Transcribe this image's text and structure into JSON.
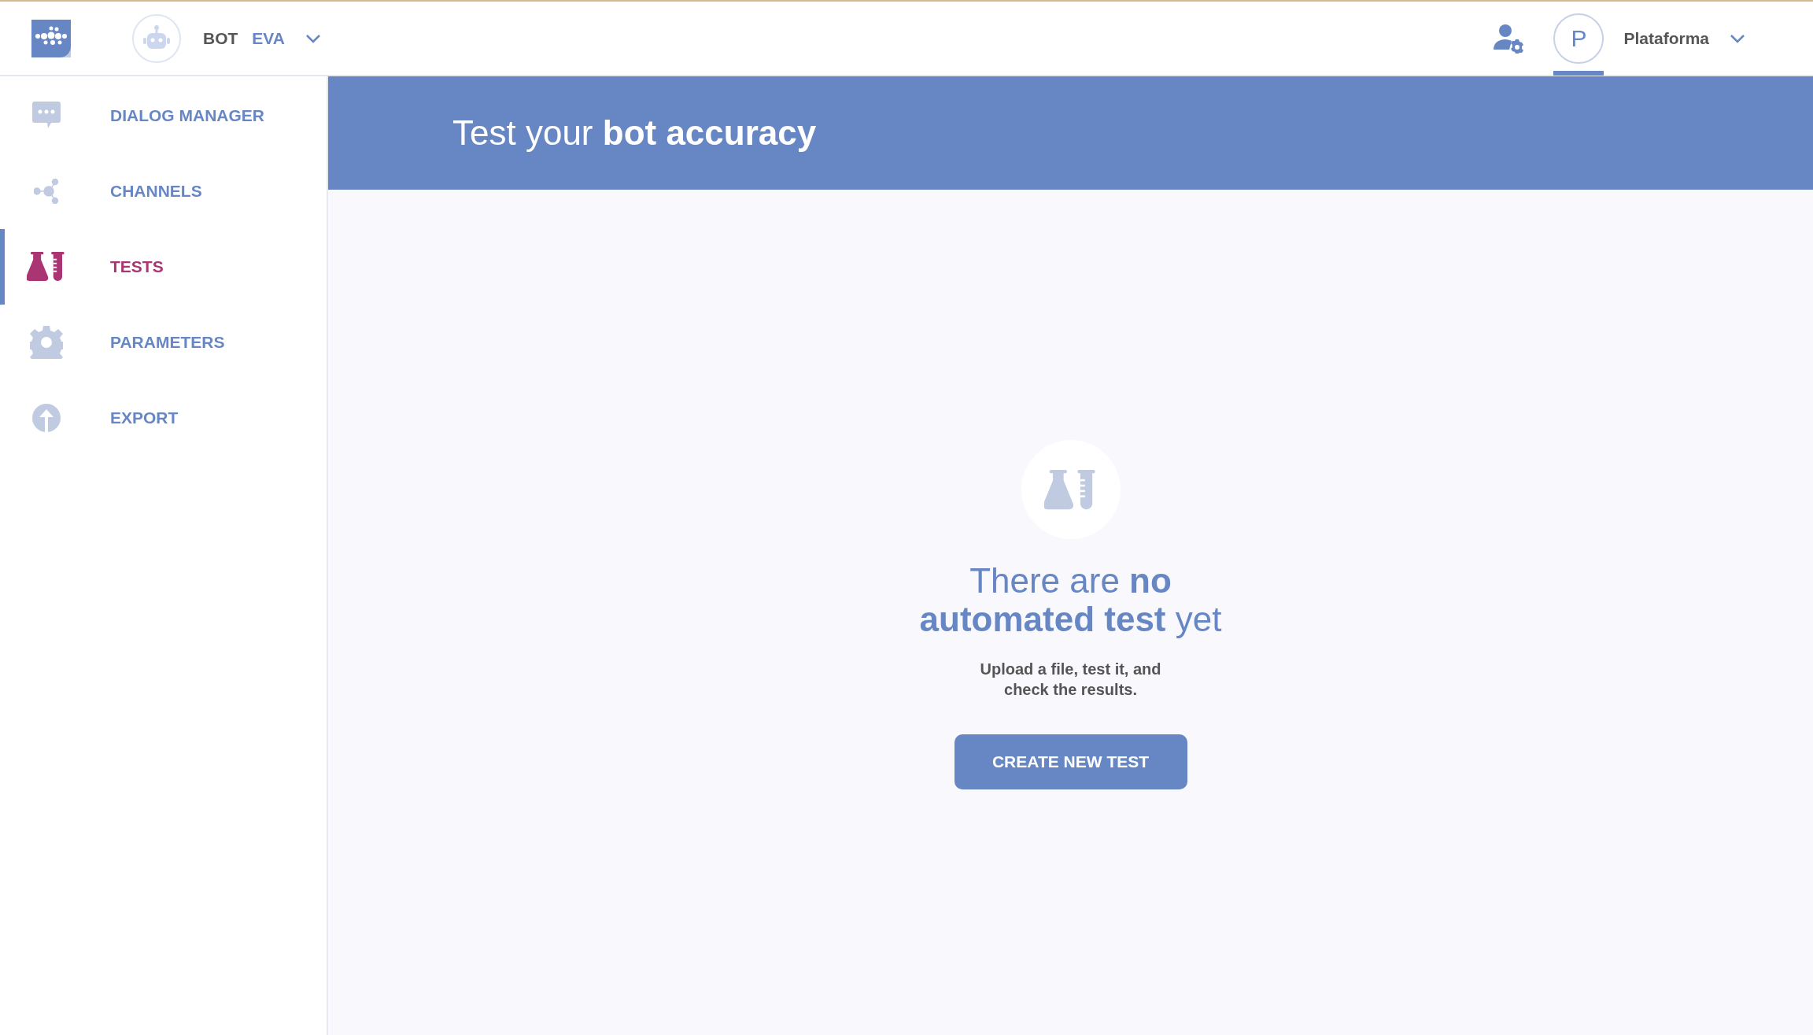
{
  "header": {
    "bot_label": "BOT",
    "bot_name": "EVA",
    "avatar_letter": "P",
    "avatar_selected": true,
    "workspace": "Plataforma"
  },
  "sidebar": {
    "items": [
      {
        "label": "DIALOG MANAGER",
        "selected": false
      },
      {
        "label": "CHANNELS",
        "selected": false
      },
      {
        "label": "TESTS",
        "selected": true
      },
      {
        "label": "PARAMETERS",
        "selected": false
      },
      {
        "label": "EXPORT",
        "selected": false
      }
    ]
  },
  "banner": {
    "title": "Test your **bot accuracy**"
  },
  "empty_state": {
    "title": "There are **no automated test** yet",
    "subtitle": "Upload a file, test it, and check the results.",
    "button": "CREATE NEW TEST"
  }
}
